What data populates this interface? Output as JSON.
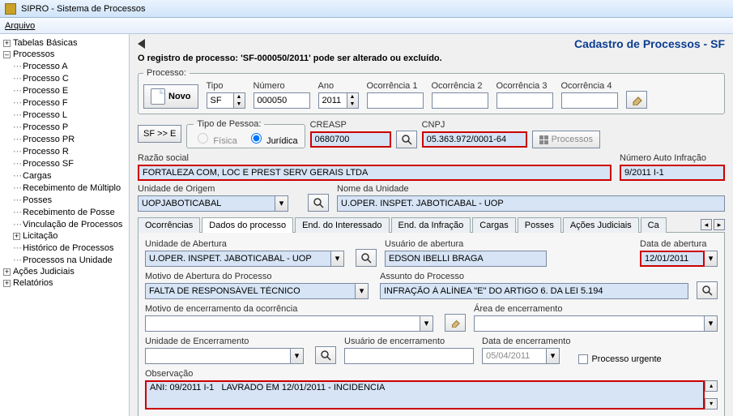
{
  "window": {
    "title": "SIPRO - Sistema de Processos"
  },
  "menu": {
    "arquivo": "Arquivo"
  },
  "tree": {
    "tabelas_basicas": "Tabelas Básicas",
    "processos": "Processos",
    "processo_a": "Processo A",
    "processo_c": "Processo C",
    "processo_e": "Processo E",
    "processo_f": "Processo F",
    "processo_l": "Processo L",
    "processo_p": "Processo P",
    "processo_pr": "Processo PR",
    "processo_r": "Processo R",
    "processo_sf": "Processo SF",
    "cargas": "Cargas",
    "receb_mult": "Recebimento de Múltiplo",
    "posses": "Posses",
    "receb_posse": "Recebimento de Posse",
    "vinc_proc": "Vinculação de Processos",
    "licitacao": "Licitação",
    "hist": "Histórico de Processos",
    "proc_unid": "Processos na Unidade",
    "acoes_jud": "Ações Judiciais",
    "relatorios": "Relatórios"
  },
  "header": {
    "title": "Cadastro de Processos -  SF"
  },
  "status": "O registro de processo: 'SF-000050/2011' pode ser alterado ou excluído.",
  "processo_group": {
    "legend": "Processo:",
    "novo_label": "Novo",
    "tipo_label": "Tipo",
    "tipo_value": "SF",
    "numero_label": "Número",
    "numero_value": "000050",
    "ano_label": "Ano",
    "ano_value": "2011",
    "oc1": "Ocorrência 1",
    "oc2": "Ocorrência 2",
    "oc3": "Ocorrência 3",
    "oc4": "Ocorrência 4"
  },
  "sfbtn": "SF >> E",
  "tipo_pessoa": {
    "legend": "Tipo de Pessoa:",
    "fisica": "Física",
    "juridica": "Jurídica"
  },
  "creasp": {
    "label": "CREASP",
    "value": "0680700"
  },
  "cnpj": {
    "label": "CNPJ",
    "value": "05.363.972/0001-64"
  },
  "processos_btn": "Processos",
  "razao": {
    "label": "Razão social",
    "value": "FORTALEZA COM, LOC E PREST SERV GERAIS LTDA"
  },
  "auto_infr": {
    "label": "Número Auto Infração",
    "value": "9/2011 I-1"
  },
  "unid_origem": {
    "label": "Unidade de Origem",
    "value": "UOPJABOTICABAL"
  },
  "nome_unid": {
    "label": "Nome da Unidade",
    "value": "U.OPER. INSPET. JABOTICABAL - UOP"
  },
  "tabs": {
    "ocorrencias": "Ocorrências",
    "dados": "Dados do processo",
    "end_int": "End. do Interessado",
    "end_inf": "End. da Infração",
    "cargas": "Cargas",
    "posses": "Posses",
    "acoes": "Ações Judiciais",
    "ca": "Ca"
  },
  "form": {
    "unid_abertura_lbl": "Unidade de Abertura",
    "unid_abertura": "U.OPER. INSPET. JABOTICABAL - UOP",
    "usuario_abertura_lbl": "Usuário de abertura",
    "usuario_abertura": "EDSON IBELLI BRAGA",
    "data_abertura_lbl": "Data de abertura",
    "data_abertura": "12/01/2011",
    "motivo_ab_lbl": "Motivo de Abertura do Processo",
    "motivo_ab": "FALTA DE RESPONSÁVEL TÉCNICO",
    "assunto_lbl": "Assunto do Processo",
    "assunto": "INFRAÇÃO À ALÍNEA \"E\" DO ARTIGO 6. DA LEI 5.194",
    "motivo_enc_lbl": "Motivo de encerramento da ocorrência",
    "area_enc_lbl": "Área de encerramento",
    "unid_enc_lbl": "Unidade de Encerramento",
    "usuario_enc_lbl": "Usuário de encerramento",
    "data_enc_lbl": "Data de encerramento",
    "data_enc": "05/04/2011",
    "proc_urg": "Processo urgente",
    "obs_lbl": "Observação",
    "obs": "ANI: 09/2011 I-1   LAVRADO EM 12/01/2011 - INCIDENCIA"
  }
}
